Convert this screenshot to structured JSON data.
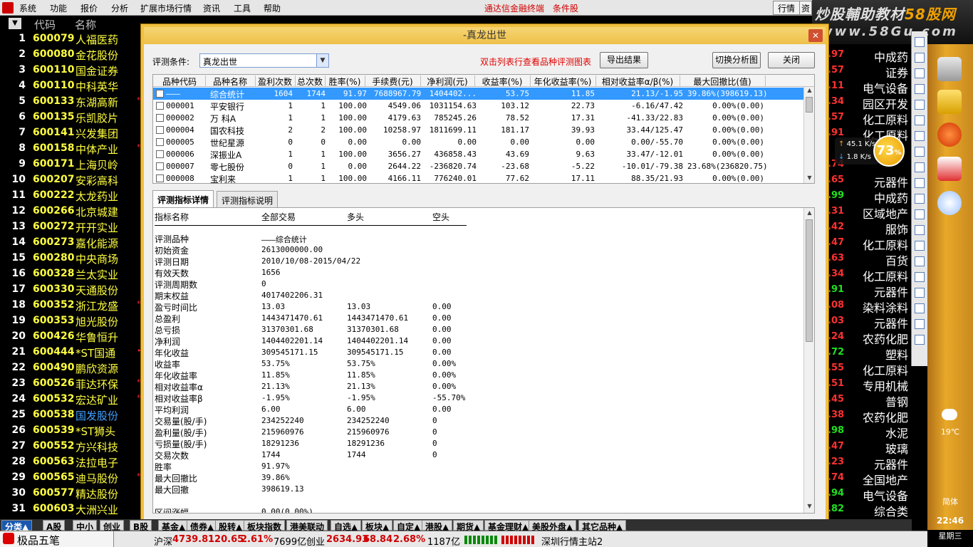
{
  "menu": {
    "items": [
      "系统",
      "功能",
      "报价",
      "分析",
      "扩展市场行情",
      "资讯",
      "工具",
      "帮助"
    ],
    "center_title": "通达信金融终端",
    "center_sub": "条件股",
    "right_btn": "行情",
    "right_btn2": "资"
  },
  "watermark": {
    "line1a": "炒股輔助教材",
    "line1b": "58股网",
    "line2": "www.58Gu.com"
  },
  "grid": {
    "sort_icon": "▼",
    "col_code": "代码",
    "col_name": "名称",
    "rows": [
      {
        "no": "1",
        "code": "600079",
        "name": "人福医药",
        "mark": ""
      },
      {
        "no": "2",
        "code": "600080",
        "name": "金花股份",
        "mark": ""
      },
      {
        "no": "3",
        "code": "600110",
        "name": "国金证券",
        "mark": ""
      },
      {
        "no": "4",
        "code": "600110",
        "name": "中科英华",
        "mark": ""
      },
      {
        "no": "5",
        "code": "600133",
        "name": "东湖高新",
        "mark": "*"
      },
      {
        "no": "6",
        "code": "600135",
        "name": "乐凯胶片",
        "mark": ""
      },
      {
        "no": "7",
        "code": "600141",
        "name": "兴发集团",
        "mark": ""
      },
      {
        "no": "8",
        "code": "600158",
        "name": "中体产业",
        "mark": "*"
      },
      {
        "no": "9",
        "code": "600171",
        "name": "上海贝岭",
        "mark": ""
      },
      {
        "no": "10",
        "code": "600207",
        "name": "安彩高科",
        "mark": ""
      },
      {
        "no": "11",
        "code": "600222",
        "name": "太龙药业",
        "mark": ""
      },
      {
        "no": "12",
        "code": "600266",
        "name": "北京城建",
        "mark": ""
      },
      {
        "no": "13",
        "code": "600272",
        "name": "开开实业",
        "mark": ""
      },
      {
        "no": "14",
        "code": "600273",
        "name": "嘉化能源",
        "mark": ""
      },
      {
        "no": "15",
        "code": "600280",
        "name": "中央商场",
        "mark": ""
      },
      {
        "no": "16",
        "code": "600328",
        "name": "兰太实业",
        "mark": ""
      },
      {
        "no": "17",
        "code": "600330",
        "name": "天通股份",
        "mark": ""
      },
      {
        "no": "18",
        "code": "600352",
        "name": "浙江龙盛",
        "mark": "*"
      },
      {
        "no": "19",
        "code": "600353",
        "name": "旭光股份",
        "mark": ""
      },
      {
        "no": "20",
        "code": "600426",
        "name": "华鲁恒升",
        "mark": ""
      },
      {
        "no": "21",
        "code": "600444",
        "name": "*ST国通",
        "mark": "•"
      },
      {
        "no": "22",
        "code": "600490",
        "name": "鹏欣资源",
        "mark": ""
      },
      {
        "no": "23",
        "code": "600526",
        "name": "菲达环保",
        "mark": "*"
      },
      {
        "no": "24",
        "code": "600532",
        "name": "宏达矿业",
        "mark": "*"
      },
      {
        "no": "25",
        "code": "600538",
        "name": "国发股份",
        "mark": "",
        "blue": true
      },
      {
        "no": "26",
        "code": "600539",
        "name": "*ST狮头",
        "mark": ""
      },
      {
        "no": "27",
        "code": "600552",
        "name": "方兴科技",
        "mark": ""
      },
      {
        "no": "28",
        "code": "600563",
        "name": "法拉电子",
        "mark": ""
      },
      {
        "no": "29",
        "code": "600565",
        "name": "迪马股份",
        "mark": "*"
      },
      {
        "no": "30",
        "code": "600577",
        "name": "精达股份",
        "mark": ""
      },
      {
        "no": "31",
        "code": "600603",
        "name": "大洲兴业",
        "mark": ""
      }
    ],
    "right": [
      {
        "v": ".97",
        "t": "中成药",
        "g": false
      },
      {
        "v": ".57",
        "t": "证券",
        "g": false
      },
      {
        "v": ".11",
        "t": "电气设备",
        "g": false
      },
      {
        "v": ".34",
        "t": "园区开发",
        "g": false
      },
      {
        "v": ".57",
        "t": "化工原料",
        "g": false
      },
      {
        "v": ".91",
        "t": "化工原料",
        "g": false
      },
      {
        "v": "",
        "t": "",
        "g": false
      },
      {
        "v": ".74",
        "t": "",
        "g": false
      },
      {
        "v": ".65",
        "t": "元器件",
        "g": false
      },
      {
        "v": ".99",
        "t": "中成药",
        "g": true
      },
      {
        "v": ".31",
        "t": "区域地产",
        "g": false
      },
      {
        "v": ".42",
        "t": "服饰",
        "g": false
      },
      {
        "v": ".47",
        "t": "化工原料",
        "g": false
      },
      {
        "v": ".63",
        "t": "百货",
        "g": false
      },
      {
        "v": ".34",
        "t": "化工原料",
        "g": false
      },
      {
        "v": ".91",
        "t": "元器件",
        "g": true
      },
      {
        "v": ".08",
        "t": "染料涂料",
        "g": false
      },
      {
        "v": ".03",
        "t": "元器件",
        "g": false
      },
      {
        "v": ".24",
        "t": "农药化肥",
        "g": false
      },
      {
        "v": ".72",
        "t": "塑料",
        "g": true
      },
      {
        "v": ".55",
        "t": "化工原料",
        "g": false
      },
      {
        "v": ".51",
        "t": "专用机械",
        "g": false
      },
      {
        "v": ".45",
        "t": "普钢",
        "g": false
      },
      {
        "v": ".38",
        "t": "农药化肥",
        "g": false
      },
      {
        "v": ".98",
        "t": "水泥",
        "g": true
      },
      {
        "v": ".47",
        "t": "玻璃",
        "g": false
      },
      {
        "v": ".23",
        "t": "元器件",
        "g": false
      },
      {
        "v": ".74",
        "t": "全国地产",
        "g": false
      },
      {
        "v": ".94",
        "t": "电气设备",
        "g": true
      },
      {
        "v": ".82",
        "t": "综合类",
        "g": true
      }
    ]
  },
  "net": {
    "up": "45.1",
    "up_unit": "K/s",
    "down": "1.8",
    "down_unit": "K/s",
    "pct": "73",
    "pct_unit": "%"
  },
  "sidebar": {
    "temp": "19℃",
    "lang": "简体",
    "time": "22:46",
    "weekday": "星期三"
  },
  "dialog": {
    "title": "-真龙出世",
    "cond_label": "评测条件:",
    "cond_value": "真龙出世",
    "hint": "双击列表行查看品种评测图表",
    "export_btn": "导出结果",
    "switch_btn": "切换分析图",
    "close_btn": "关闭",
    "table": {
      "headers": [
        "品种代码",
        "品种名称",
        "盈利次数",
        "总次数",
        "胜率(%)",
        "手续费(元)",
        "净利润(元)",
        "收益率(%)",
        "年化收益率(%)",
        "相对收益率α/β(%)",
        "最大回撤比(值)"
      ],
      "rows": [
        {
          "code": "———",
          "name": "综合统计",
          "win": "1604",
          "total": "1744",
          "rate": "91.97",
          "fee": "7688967.79",
          "profit": "1404402...",
          "ret": "53.75",
          "annual": "11.85",
          "rel": "21.13/-1.95",
          "dd": "39.86%(398619.13)",
          "hl": true
        },
        {
          "code": "000001",
          "name": "平安银行",
          "win": "1",
          "total": "1",
          "rate": "100.00",
          "fee": "4549.06",
          "profit": "1031154.63",
          "ret": "103.12",
          "annual": "22.73",
          "rel": "-6.16/47.42",
          "dd": "0.00%(0.00)"
        },
        {
          "code": "000002",
          "name": "万 科A",
          "win": "1",
          "total": "1",
          "rate": "100.00",
          "fee": "4179.63",
          "profit": "785245.26",
          "ret": "78.52",
          "annual": "17.31",
          "rel": "-41.33/22.83",
          "dd": "0.00%(0.00)"
        },
        {
          "code": "000004",
          "name": "国农科技",
          "win": "2",
          "total": "2",
          "rate": "100.00",
          "fee": "10258.97",
          "profit": "1811699.11",
          "ret": "181.17",
          "annual": "39.93",
          "rel": "33.44/125.47",
          "dd": "0.00%(0.00)"
        },
        {
          "code": "000005",
          "name": "世纪星源",
          "win": "0",
          "total": "0",
          "rate": "0.00",
          "fee": "0.00",
          "profit": "0.00",
          "ret": "0.00",
          "annual": "0.00",
          "rel": "0.00/-55.70",
          "dd": "0.00%(0.00)"
        },
        {
          "code": "000006",
          "name": "深振业A",
          "win": "1",
          "total": "1",
          "rate": "100.00",
          "fee": "3656.27",
          "profit": "436858.43",
          "ret": "43.69",
          "annual": "9.63",
          "rel": "33.47/-12.01",
          "dd": "0.00%(0.00)"
        },
        {
          "code": "000007",
          "name": "零七股份",
          "win": "0",
          "total": "1",
          "rate": "0.00",
          "fee": "2644.22",
          "profit": "-236820.74",
          "ret": "-23.68",
          "annual": "-5.22",
          "rel": "-10.01/-79.38",
          "dd": "23.68%(236820.75)"
        },
        {
          "code": "000008",
          "name": "宝利来",
          "win": "1",
          "total": "1",
          "rate": "100.00",
          "fee": "4166.11",
          "profit": "776240.01",
          "ret": "77.62",
          "annual": "17.11",
          "rel": "88.35/21.93",
          "dd": "0.00%(0.00)"
        }
      ]
    },
    "tabs": [
      "评测指标详情",
      "评测指标说明"
    ],
    "detail": {
      "headers": [
        "指标名称",
        "全部交易",
        "多头",
        "空头"
      ],
      "rows": [
        {
          "k": "评测品种",
          "a": "———综合统计",
          "b": "",
          "c": ""
        },
        {
          "k": "初始资金",
          "a": "2613000000.00",
          "b": "",
          "c": ""
        },
        {
          "k": "评测日期",
          "a": "2010/10/08-2015/04/22",
          "b": "",
          "c": ""
        },
        {
          "k": "有效天数",
          "a": "1656",
          "b": "",
          "c": ""
        },
        {
          "k": "评测周期数",
          "a": "0",
          "b": "",
          "c": ""
        },
        {
          "k": "期末权益",
          "a": "4017402206.31",
          "b": "",
          "c": ""
        },
        {
          "k": "盈亏时间比",
          "a": "13.03",
          "b": "13.03",
          "c": "0.00"
        },
        {
          "k": "总盈利",
          "a": "1443471470.61",
          "b": "1443471470.61",
          "c": "0.00"
        },
        {
          "k": "总亏损",
          "a": "31370301.68",
          "b": "31370301.68",
          "c": "0.00"
        },
        {
          "k": "净利润",
          "a": "1404402201.14",
          "b": "1404402201.14",
          "c": "0.00"
        },
        {
          "k": "年化收益",
          "a": "309545171.15",
          "b": "309545171.15",
          "c": "0.00"
        },
        {
          "k": "收益率",
          "a": "53.75%",
          "b": "53.75%",
          "c": "0.00%"
        },
        {
          "k": "年化收益率",
          "a": "11.85%",
          "b": "11.85%",
          "c": "0.00%"
        },
        {
          "k": "相对收益率α",
          "a": "21.13%",
          "b": " 21.13%",
          "c": "  0.00%"
        },
        {
          "k": "相对收益率β",
          "a": "-1.95%",
          "b": " -1.95%",
          "c": "  -55.70%"
        },
        {
          "k": "平均利润",
          "a": "6.00",
          "b": "6.00",
          "c": "0.00"
        },
        {
          "k": "交易量(股/手)",
          "a": "234252240",
          "b": "234252240",
          "c": "0"
        },
        {
          "k": "盈利量(股/手)",
          "a": "215960976",
          "b": "215960976",
          "c": "0"
        },
        {
          "k": "亏损量(股/手)",
          "a": "18291236",
          "b": "18291236",
          "c": "0"
        },
        {
          "k": "交易次数",
          "a": "1744",
          "b": "1744",
          "c": "0"
        },
        {
          "k": "胜率",
          "a": "91.97%",
          "b": "",
          "c": ""
        },
        {
          "k": "最大回撤比",
          "a": "39.86%",
          "b": "",
          "c": ""
        },
        {
          "k": "最大回撤",
          "a": "398619.13",
          "b": "",
          "c": ""
        },
        {
          "k": "",
          "a": "",
          "b": "",
          "c": ""
        },
        {
          "k": "区间涨幅",
          "a": "0.00(0.00%)",
          "b": "",
          "c": ""
        }
      ]
    }
  },
  "bottom_tabs": [
    "分类▲",
    "A股",
    "中小",
    "创业",
    "B股",
    "基金▲",
    "债券▲",
    "股转▲",
    "板块指数",
    "港美联动",
    "自选▲",
    "板块▲",
    "自定▲",
    "港股▲",
    "期货▲",
    "基金理财▲",
    "美股外盘▲",
    "其它品种▲"
  ],
  "status": {
    "brand": "极品五笔",
    "sh_label": "沪深",
    "sh_index": "4739.81",
    "sh_chg": "120.65",
    "sh_pct": "2.61%",
    "sh_amt": "7699亿",
    "cy_label": "创业",
    "cy_index": "2634.93",
    "cy_chg": "68.84",
    "cy_pct": "2.68%",
    "cy_amt": "1187亿",
    "server": "深圳行情主站2"
  }
}
